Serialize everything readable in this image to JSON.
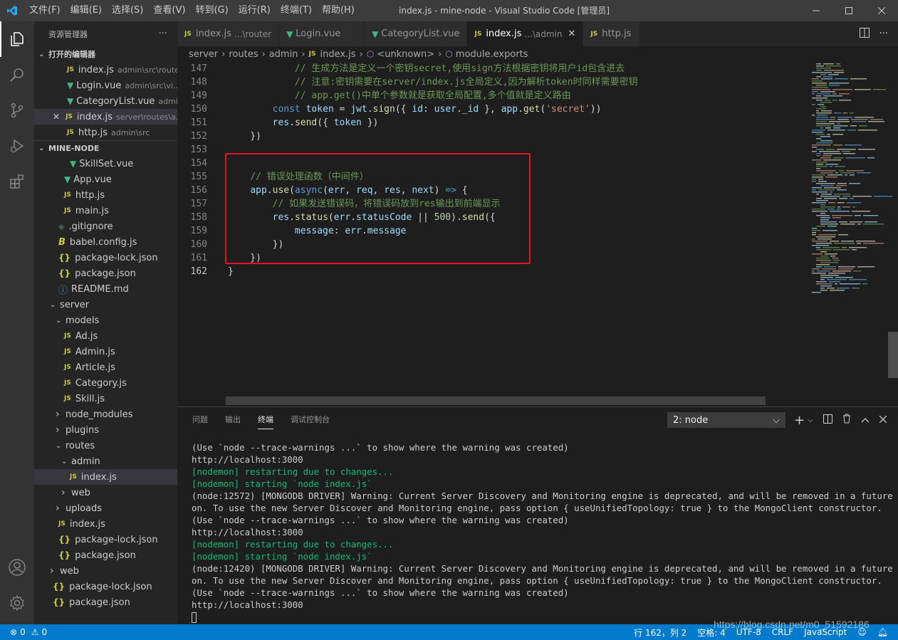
{
  "menu": [
    "文件(F)",
    "编辑(E)",
    "选择(S)",
    "查看(V)",
    "转到(G)",
    "运行(R)",
    "终端(T)",
    "帮助(H)"
  ],
  "window_title": "index.js - mine-node - Visual Studio Code [管理员]",
  "sidebar": {
    "header": "资源管理器",
    "more": "···",
    "open_editors_title": "打开的编辑器",
    "open_editors": [
      {
        "name": "index.js",
        "path": "admin\\src\\router",
        "icon": "js"
      },
      {
        "name": "Login.vue",
        "path": "admin\\src\\vi...",
        "icon": "vue"
      },
      {
        "name": "CategoryList.vue",
        "path": "admi...",
        "icon": "vue"
      },
      {
        "name": "index.js",
        "path": "server\\routes\\a...",
        "icon": "js"
      },
      {
        "name": "http.js",
        "path": "admin\\src",
        "icon": "js"
      }
    ],
    "project_title": "MINE-NODE",
    "tree": [
      {
        "name": "SkillSet.vue",
        "icon": "vue",
        "indent": 2
      },
      {
        "name": "App.vue",
        "icon": "vue",
        "indent": 1
      },
      {
        "name": "http.js",
        "icon": "js",
        "indent": 1
      },
      {
        "name": "main.js",
        "icon": "js",
        "indent": 1
      },
      {
        "name": ".gitignore",
        "icon": "git",
        "indent": 0
      },
      {
        "name": "babel.config.js",
        "icon": "babel",
        "indent": 0
      },
      {
        "name": "package-lock.json",
        "icon": "json",
        "indent": 0
      },
      {
        "name": "package.json",
        "icon": "json",
        "indent": 0
      },
      {
        "name": "README.md",
        "icon": "info",
        "indent": 0
      },
      {
        "name": "server",
        "icon": "folder-open",
        "indent": -1
      },
      {
        "name": "models",
        "icon": "folder-open",
        "indent": 0
      },
      {
        "name": "Ad.js",
        "icon": "js",
        "indent": 1
      },
      {
        "name": "Admin.js",
        "icon": "js",
        "indent": 1
      },
      {
        "name": "Article.js",
        "icon": "js",
        "indent": 1
      },
      {
        "name": "Category.js",
        "icon": "js",
        "indent": 1
      },
      {
        "name": "Skill.js",
        "icon": "js",
        "indent": 1
      },
      {
        "name": "node_modules",
        "icon": "folder",
        "indent": 0
      },
      {
        "name": "plugins",
        "icon": "folder",
        "indent": 0
      },
      {
        "name": "routes",
        "icon": "folder-open",
        "indent": 0
      },
      {
        "name": "admin",
        "icon": "folder-open",
        "indent": 1
      },
      {
        "name": "index.js",
        "icon": "js",
        "indent": 2,
        "selected": true
      },
      {
        "name": "web",
        "icon": "folder",
        "indent": 1
      },
      {
        "name": "uploads",
        "icon": "folder",
        "indent": 0
      },
      {
        "name": "index.js",
        "icon": "js",
        "indent": 0
      },
      {
        "name": "package-lock.json",
        "icon": "json",
        "indent": 0
      },
      {
        "name": "package.json",
        "icon": "json",
        "indent": 0
      },
      {
        "name": "web",
        "icon": "folder",
        "indent": -1
      },
      {
        "name": "package-lock.json",
        "icon": "json",
        "indent": -1
      },
      {
        "name": "package.json",
        "icon": "json",
        "indent": -1
      }
    ]
  },
  "tabs": [
    {
      "name": "index.js",
      "path": "...\\router",
      "icon": "js",
      "active": false
    },
    {
      "name": "Login.vue",
      "path": "",
      "icon": "vue",
      "active": false
    },
    {
      "name": "CategoryList.vue",
      "path": "",
      "icon": "vue",
      "active": false
    },
    {
      "name": "index.js",
      "path": "...\\admin",
      "icon": "js",
      "active": true
    },
    {
      "name": "http.js",
      "path": "",
      "icon": "js",
      "active": false
    }
  ],
  "breadcrumb": [
    "server",
    "routes",
    "admin",
    "index.js",
    "<unknown>",
    "module.exports"
  ],
  "editor": {
    "lines": [
      {
        "n": "147",
        "parts": [
          [
            "pl",
            "            "
          ],
          [
            "com",
            "// 生成方法是定义一个密钥secret,使用sign方法根据密钥将用户id包含进去"
          ]
        ]
      },
      {
        "n": "148",
        "parts": [
          [
            "pl",
            "            "
          ],
          [
            "com",
            "// 注意:密钥需要在server/index.js全局定义,因为解析token时同样需要密钥"
          ]
        ]
      },
      {
        "n": "149",
        "parts": [
          [
            "pl",
            "            "
          ],
          [
            "com",
            "// app.get()中单个参数就是获取全局配置,多个值就是定义路由"
          ]
        ]
      },
      {
        "n": "150",
        "parts": [
          [
            "pl",
            "        "
          ],
          [
            "kw",
            "const "
          ],
          [
            "var",
            "token"
          ],
          [
            "pl",
            " = "
          ],
          [
            "var",
            "jwt"
          ],
          [
            "pl",
            "."
          ],
          [
            "fn",
            "sign"
          ],
          [
            "pl",
            "({ "
          ],
          [
            "var",
            "id"
          ],
          [
            "pl",
            ": "
          ],
          [
            "var",
            "user"
          ],
          [
            "pl",
            "."
          ],
          [
            "var",
            "_id"
          ],
          [
            "pl",
            " }, "
          ],
          [
            "var",
            "app"
          ],
          [
            "pl",
            "."
          ],
          [
            "fn",
            "get"
          ],
          [
            "pl",
            "("
          ],
          [
            "str",
            "'secret'"
          ],
          [
            "pl",
            "))"
          ]
        ]
      },
      {
        "n": "151",
        "parts": [
          [
            "pl",
            "        "
          ],
          [
            "var",
            "res"
          ],
          [
            "pl",
            "."
          ],
          [
            "fn",
            "send"
          ],
          [
            "pl",
            "({ "
          ],
          [
            "var",
            "token"
          ],
          [
            "pl",
            " })"
          ]
        ]
      },
      {
        "n": "152",
        "parts": [
          [
            "pl",
            "    })"
          ]
        ]
      },
      {
        "n": "153",
        "parts": []
      },
      {
        "n": "154",
        "parts": []
      },
      {
        "n": "155",
        "parts": [
          [
            "pl",
            "    "
          ],
          [
            "com",
            "// 错误处理函数（中间件）"
          ]
        ]
      },
      {
        "n": "156",
        "parts": [
          [
            "pl",
            "    "
          ],
          [
            "var",
            "app"
          ],
          [
            "pl",
            "."
          ],
          [
            "fn",
            "use"
          ],
          [
            "pl",
            "("
          ],
          [
            "kw",
            "async"
          ],
          [
            "pl",
            "("
          ],
          [
            "var",
            "err"
          ],
          [
            "pl",
            ", "
          ],
          [
            "var",
            "req"
          ],
          [
            "pl",
            ", "
          ],
          [
            "var",
            "res"
          ],
          [
            "pl",
            ", "
          ],
          [
            "var",
            "next"
          ],
          [
            "pl",
            ") "
          ],
          [
            "kw",
            "=>"
          ],
          [
            "pl",
            " {"
          ]
        ]
      },
      {
        "n": "157",
        "parts": [
          [
            "pl",
            "        "
          ],
          [
            "com",
            "// 如果发送错误码，将错误码放到res输出到前端显示"
          ]
        ]
      },
      {
        "n": "158",
        "parts": [
          [
            "pl",
            "        "
          ],
          [
            "var",
            "res"
          ],
          [
            "pl",
            "."
          ],
          [
            "fn",
            "status"
          ],
          [
            "pl",
            "("
          ],
          [
            "var",
            "err"
          ],
          [
            "pl",
            "."
          ],
          [
            "var",
            "statusCode"
          ],
          [
            "pl",
            " || "
          ],
          [
            "num",
            "500"
          ],
          [
            "pl",
            ")."
          ],
          [
            "fn",
            "send"
          ],
          [
            "pl",
            "({"
          ]
        ]
      },
      {
        "n": "159",
        "parts": [
          [
            "pl",
            "            "
          ],
          [
            "var",
            "message"
          ],
          [
            "pl",
            ": "
          ],
          [
            "var",
            "err"
          ],
          [
            "pl",
            "."
          ],
          [
            "var",
            "message"
          ]
        ]
      },
      {
        "n": "160",
        "parts": [
          [
            "pl",
            "        })"
          ]
        ]
      },
      {
        "n": "161",
        "parts": [
          [
            "pl",
            "    })"
          ]
        ]
      },
      {
        "n": "162",
        "parts": [
          [
            "pl",
            "}"
          ]
        ],
        "current": true
      }
    ]
  },
  "panel": {
    "tabs": [
      "问题",
      "输出",
      "终端",
      "调试控制台"
    ],
    "active_tab": "终端",
    "terminal_select": "2: node",
    "terminal_lines": [
      {
        "t": "(Use `node --trace-warnings ...` to show where the warning was created)",
        "c": "n"
      },
      {
        "t": "http://localhost:3000",
        "c": "n"
      },
      {
        "t": "[nodemon] restarting due to changes...",
        "c": "g"
      },
      {
        "t": "[nodemon] starting `node index.js`",
        "c": "g"
      },
      {
        "t": "(node:12572) [MONGODB DRIVER] Warning: Current Server Discovery and Monitoring engine is deprecated, and will be removed in a future versi",
        "c": "n"
      },
      {
        "t": "on. To use the new Server Discover and Monitoring engine, pass option { useUnifiedTopology: true } to the MongoClient constructor.",
        "c": "n"
      },
      {
        "t": "(Use `node --trace-warnings ...` to show where the warning was created)",
        "c": "n"
      },
      {
        "t": "http://localhost:3000",
        "c": "n"
      },
      {
        "t": "[nodemon] restarting due to changes...",
        "c": "g"
      },
      {
        "t": "[nodemon] starting `node index.js`",
        "c": "g"
      },
      {
        "t": "(node:12420) [MONGODB DRIVER] Warning: Current Server Discovery and Monitoring engine is deprecated, and will be removed in a future versi",
        "c": "n"
      },
      {
        "t": "on. To use the new Server Discover and Monitoring engine, pass option { useUnifiedTopology: true } to the MongoClient constructor.",
        "c": "n"
      },
      {
        "t": "(Use `node --trace-warnings ...` to show where the warning was created)",
        "c": "n"
      },
      {
        "t": "http://localhost:3000",
        "c": "n"
      }
    ]
  },
  "status": {
    "errors": "0",
    "warnings": "0",
    "position": "行 162，列 2",
    "spaces": "空格: 4",
    "encoding": "UTF-8",
    "eol": "CRLF",
    "language": "JavaScript"
  },
  "watermark": "https://blog.csdn.net/m0_51592186"
}
